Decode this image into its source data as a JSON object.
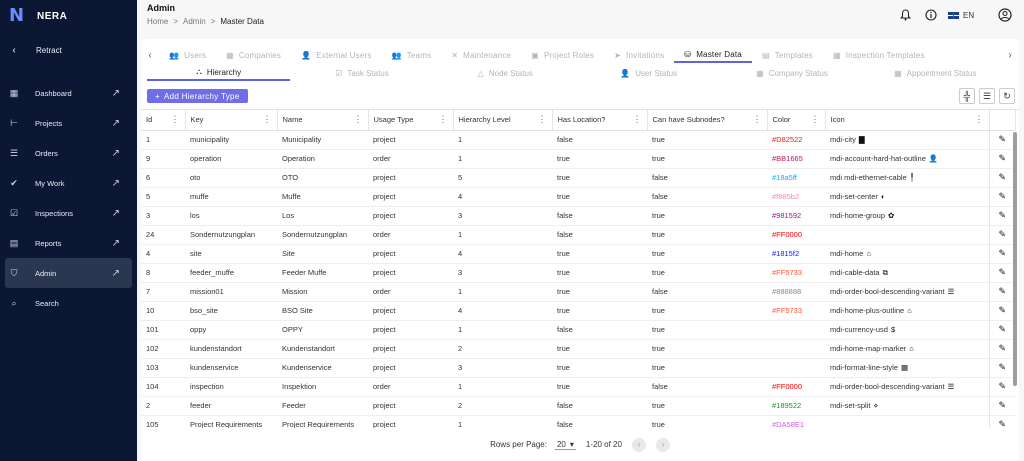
{
  "app": {
    "name": "NERA"
  },
  "sidebar": {
    "retract_label": "Retract",
    "items": [
      {
        "label": "Dashboard",
        "icon": "dashboard-icon"
      },
      {
        "label": "Projects",
        "icon": "projects-icon"
      },
      {
        "label": "Orders",
        "icon": "orders-icon"
      },
      {
        "label": "My Work",
        "icon": "my-work-icon"
      },
      {
        "label": "Inspections",
        "icon": "inspections-icon"
      },
      {
        "label": "Reports",
        "icon": "reports-icon"
      },
      {
        "label": "Admin",
        "icon": "shield-icon"
      },
      {
        "label": "Search",
        "icon": "search-icon"
      }
    ]
  },
  "header": {
    "title": "Admin",
    "breadcrumb": [
      "Home",
      "Admin",
      "Master Data"
    ],
    "language": "EN"
  },
  "tabs": [
    {
      "label": "Users"
    },
    {
      "label": "Companies"
    },
    {
      "label": "External Users"
    },
    {
      "label": "Teams"
    },
    {
      "label": "Maintenance"
    },
    {
      "label": "Project Roles"
    },
    {
      "label": "Invitations"
    },
    {
      "label": "Master Data"
    },
    {
      "label": "Templates"
    },
    {
      "label": "Inspection Templates"
    }
  ],
  "subtabs": [
    {
      "label": "Hierarchy"
    },
    {
      "label": "Task Status"
    },
    {
      "label": "Node Status"
    },
    {
      "label": "User Status"
    },
    {
      "label": "Company Status"
    },
    {
      "label": "Appointment Status"
    }
  ],
  "add_button_label": "Add Hierarchy Type",
  "table": {
    "columns": [
      "Id",
      "Key",
      "Name",
      "Usage Type",
      "Hierarchy Level",
      "Has Location?",
      "Can have Subnodes?",
      "Color",
      "Icon"
    ],
    "rows": [
      [
        "1",
        "municipality",
        "Municipality",
        "project",
        "1",
        "false",
        "true",
        "#D82522",
        "mdi-city"
      ],
      [
        "9",
        "operation",
        "Operation",
        "order",
        "1",
        "true",
        "true",
        "#BB1665",
        "mdi-account-hard-hat-outline"
      ],
      [
        "6",
        "oto",
        "OTO",
        "project",
        "5",
        "true",
        "false",
        "#18a5ff",
        "mdi mdi-ethernet-cable"
      ],
      [
        "5",
        "muffe",
        "Muffe",
        "project",
        "4",
        "true",
        "false",
        "#f885b2",
        "mdi-set-center"
      ],
      [
        "3",
        "los",
        "Los",
        "project",
        "3",
        "false",
        "true",
        "#981592",
        "mdi-home-group"
      ],
      [
        "24",
        "Sondernutzungplan",
        "Sondernutzungplan",
        "order",
        "1",
        "false",
        "true",
        "#FF0000",
        ""
      ],
      [
        "4",
        "site",
        "Site",
        "project",
        "4",
        "true",
        "true",
        "#1815f2",
        "mdi-home"
      ],
      [
        "8",
        "feeder_muffe",
        "Feeder Muffe",
        "project",
        "3",
        "true",
        "true",
        "#FF5733",
        "mdi-cable-data"
      ],
      [
        "7",
        "mission01",
        "Mission",
        "order",
        "1",
        "true",
        "false",
        "#888888",
        "mdi-order-bool-descending-variant"
      ],
      [
        "10",
        "bso_site",
        "BSO Site",
        "project",
        "4",
        "true",
        "true",
        "#FF5733",
        "mdi-home-plus-outline"
      ],
      [
        "101",
        "oppy",
        "OPPY",
        "project",
        "1",
        "false",
        "true",
        "",
        "mdi-currency-usd"
      ],
      [
        "102",
        "kundenstandort",
        "Kundenstandort",
        "project",
        "2",
        "true",
        "true",
        "",
        "mdi-home-map-marker"
      ],
      [
        "103",
        "kundenservice",
        "Kundenservice",
        "project",
        "3",
        "true",
        "true",
        "",
        "mdi-format-line-style"
      ],
      [
        "104",
        "inspection",
        "Inspektion",
        "order",
        "1",
        "true",
        "false",
        "#FF0000",
        "mdi-order-bool-descending-variant"
      ],
      [
        "2",
        "feeder",
        "Feeder",
        "project",
        "2",
        "false",
        "true",
        "#189522",
        "mdi-set-split"
      ],
      [
        "105",
        "Project Requirements",
        "Project Requirements",
        "project",
        "1",
        "false",
        "true",
        "#DA58E1",
        ""
      ]
    ],
    "row_icon_glyphs": [
      "▇",
      "👤",
      "╿",
      "◐",
      "✿",
      "",
      "⌂",
      "⧉",
      "☰",
      "⌂",
      "$",
      "⌂",
      "▦",
      "☰",
      "⋄",
      ""
    ]
  },
  "footer": {
    "rows_per_page_label": "Rows per Page:",
    "rows_per_page_value": "20",
    "range": "1-20 of 20"
  }
}
